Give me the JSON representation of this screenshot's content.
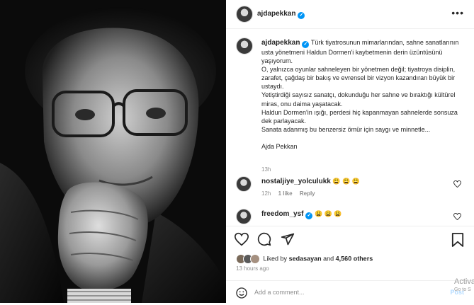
{
  "post": {
    "username": "ajdapekkan",
    "more_icon": "more-horizontal-icon"
  },
  "caption": {
    "username": "ajdapekkan",
    "p1": "Türk tiyatrosunun mimarlarından, sahne sanatlarının usta yönetmeni Haldun Dormen'i kaybetmenin derin üzüntüsünü yaşıyorum.",
    "p2": "O, yalnızca oyunlar sahneleyen bir yönetmen değil; tiyatroya disiplin, zarafet, çağdaş bir bakış ve evrensel bir vizyon kazandıran büyük bir ustaydı.",
    "p3": "Yetiştirdiği sayısız sanatçı, dokunduğu her sahne ve bıraktığı kültürel miras, onu daima yaşatacak.",
    "p4": "Haldun Dormen'in ışığı, perdesi hiç kapanmayan sahnelerde sonsuza dek parlayacak.",
    "p5": "Sanata adanmış bu benzersiz ömür için saygı ve minnetle...",
    "p6": "Ajda Pekkan",
    "time": "13h"
  },
  "comments": [
    {
      "username": "nostaljiye_yolculukk",
      "text": "😩 😩 😩",
      "time": "12h",
      "likes": "1 like",
      "reply": "Reply"
    },
    {
      "username": "freedom_ysf",
      "text": "😩 😩 😩",
      "time": "",
      "likes": "",
      "reply": ""
    }
  ],
  "likes": {
    "prefix": "Liked by",
    "user": "sedasayan",
    "mid": "and",
    "count": "4,560 others"
  },
  "posted_ago": "13 hours ago",
  "comment_box": {
    "placeholder": "Add a comment...",
    "post_label": "Post"
  },
  "watermark": {
    "line1": "Activa",
    "line2": "Go to S"
  },
  "colors": {
    "verified": "#0095f6",
    "muted_text": "#8e8e8e",
    "post_button": "#b3dbff"
  }
}
